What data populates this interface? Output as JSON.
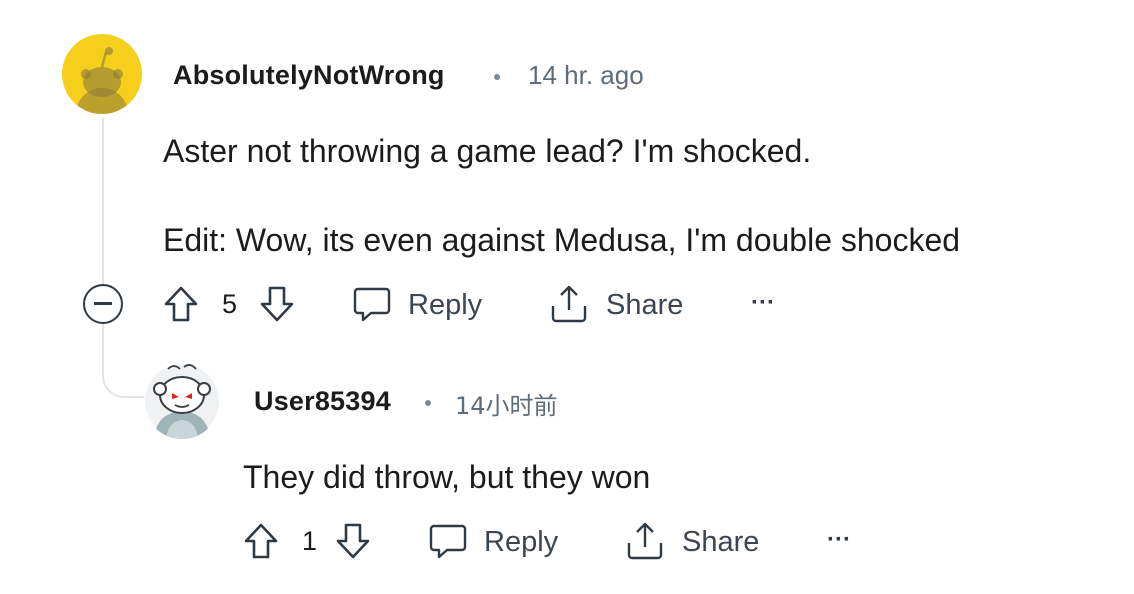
{
  "comment": {
    "author": "AbsolutelyNotWrong",
    "time": "14 hr. ago",
    "text_line1": "Aster not throwing a game lead? I'm shocked.",
    "text_line2": "Edit: Wow, its even against Medusa, I'm double shocked",
    "votes": "5",
    "reply_label": "Reply",
    "share_label": "Share",
    "more_label": "···"
  },
  "reply": {
    "author": "User85394",
    "time": "14小时前",
    "text": "They did throw, but they won",
    "votes": "1",
    "reply_label": "Reply",
    "share_label": "Share",
    "more_label": "···"
  },
  "colors": {
    "avatar1_bg": "#f6cf1d",
    "thread_line": "#e2e4e6",
    "text": "#1c1c1c",
    "meta": "#5f6b76"
  }
}
